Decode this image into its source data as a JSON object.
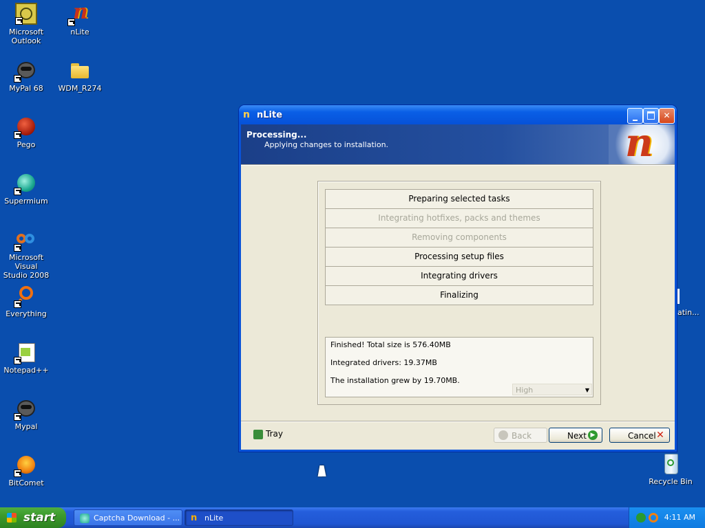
{
  "desktop": {
    "icons": [
      {
        "label": "Microsoft\nOutlook",
        "icon": "outlook-icon"
      },
      {
        "label": "nLite",
        "icon": "nlite-icon"
      },
      {
        "label": "MyPal 68",
        "icon": "mypal-icon"
      },
      {
        "label": "WDM_R274",
        "icon": "folder-icon"
      },
      {
        "label": "Pego",
        "icon": "pego-icon"
      },
      {
        "label": "Supermium",
        "icon": "supermium-icon"
      },
      {
        "label": "Microsoft Visual\nStudio 2008",
        "icon": "visual-studio-icon"
      },
      {
        "label": "Everything",
        "icon": "everything-icon"
      },
      {
        "label": "Notepad++",
        "icon": "notepadpp-icon"
      },
      {
        "label": "Mypal",
        "icon": "mypal-icon"
      },
      {
        "label": "BitComet",
        "icon": "bitcomet-icon"
      },
      {
        "label": "Recycle Bin",
        "icon": "recycle-bin-icon"
      }
    ],
    "partial_label": "atin..."
  },
  "window": {
    "title": "nLite",
    "header_title": "Processing...",
    "header_subtitle": "Applying changes to installation.",
    "tasks": [
      {
        "label": "Preparing selected tasks",
        "enabled": true
      },
      {
        "label": "Integrating hotfixes, packs and themes",
        "enabled": false
      },
      {
        "label": "Removing components",
        "enabled": false
      },
      {
        "label": "Processing setup files",
        "enabled": true
      },
      {
        "label": "Integrating drivers",
        "enabled": true
      },
      {
        "label": "Finalizing",
        "enabled": true
      }
    ],
    "info": {
      "line1": "Finished! Total size is 576.40MB",
      "line2": "Integrated drivers: 19.37MB",
      "line3": "The installation grew by 19.70MB."
    },
    "priority_select": "High",
    "buttons": {
      "tray": "Tray",
      "back": "Back",
      "next": "Next",
      "cancel": "Cancel"
    }
  },
  "taskbar": {
    "start": "start",
    "items": [
      {
        "label": "Captcha Download - ...",
        "active": false
      },
      {
        "label": "nLite",
        "active": true
      }
    ],
    "clock": "4:11 AM"
  },
  "colors": {
    "desktop": "#0a4eae",
    "title_bar": "#0651d8",
    "header": "#1b3f88",
    "start_green": "#3c9a2c"
  }
}
